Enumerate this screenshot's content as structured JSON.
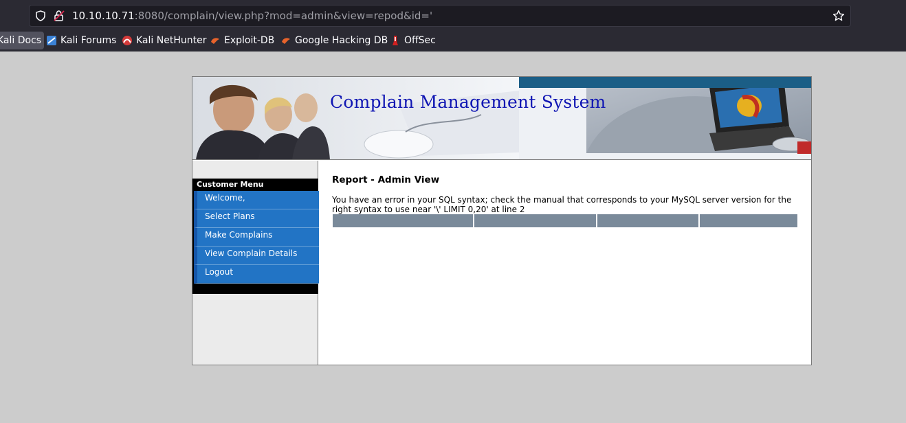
{
  "browser": {
    "url_host": "10.10.10.71",
    "url_rest": ":8080/complain/view.php?mod=admin&view=repod&id='",
    "bookmarks": [
      "Kali Docs",
      "Kali Forums",
      "Kali NetHunter",
      "Exploit-DB",
      "Google Hacking DB",
      "OffSec"
    ]
  },
  "banner": {
    "title": "Complain Management System"
  },
  "sidebar": {
    "menu_title": "Customer Menu",
    "items": [
      "Welcome,",
      "Select Plans",
      "Make Complains",
      "View Complain Details",
      "Logout"
    ]
  },
  "main": {
    "title": "Report - Admin View",
    "error": "You have an error in your SQL syntax; check the manual that corresponds to your MySQL server version for the right syntax to use near '\\' LIMIT 0,20' at line 2"
  },
  "colors": {
    "menu_item": "#2274c5",
    "title_blue": "#1016b3",
    "table_header": "#7a8a9a"
  }
}
